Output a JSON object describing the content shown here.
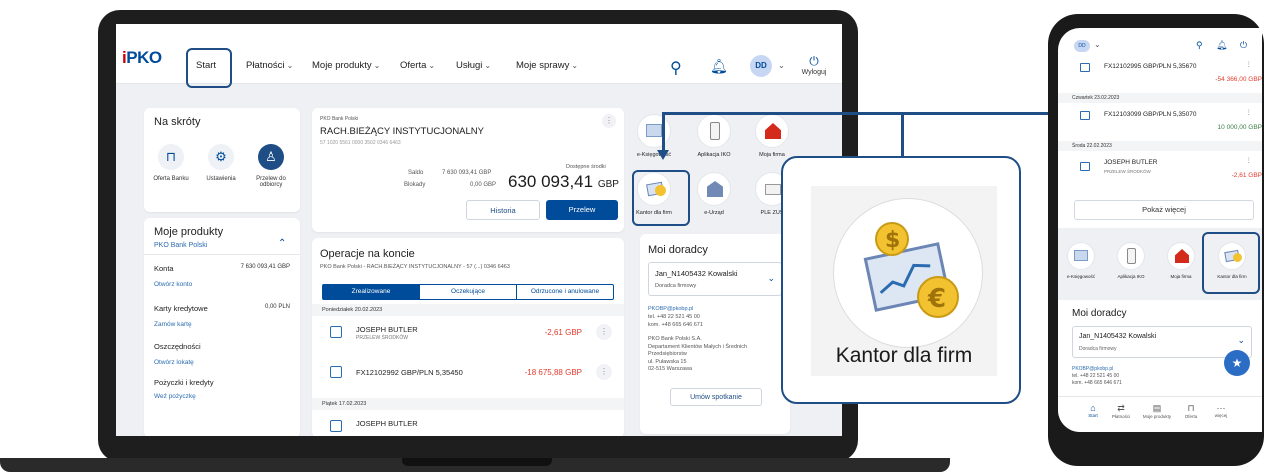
{
  "laptop": {
    "brand": "PKO",
    "nav": [
      {
        "label": "Start",
        "chev": false
      },
      {
        "label": "Płatności",
        "chev": true
      },
      {
        "label": "Moje produkty",
        "chev": true
      },
      {
        "label": "Oferta",
        "chev": true
      },
      {
        "label": "Usługi",
        "chev": true
      },
      {
        "label": "Moje sprawy",
        "chev": true
      }
    ],
    "avatar_initials": "DD",
    "logout_label": "Wyloguj",
    "shortcuts": {
      "title": "Na skróty",
      "items": [
        {
          "label": "Oferta Banku",
          "icon": "bag-icon"
        },
        {
          "label": "Ustawienia",
          "icon": "gear-icon"
        },
        {
          "label": "Przelew do odbiorcy",
          "icon": "person-icon"
        }
      ]
    },
    "products": {
      "title": "Moje produkty",
      "bank": "PKO Bank Polski",
      "rows": [
        {
          "label": "Konta",
          "value": "7 630 093,41 GBP",
          "link": "Otwórz konto"
        },
        {
          "label": "Karty kredytowe",
          "value": "0,00 PLN",
          "link": "Zamów kartę"
        },
        {
          "label": "Oszczędności",
          "value": "",
          "link": "Otwórz lokatę"
        },
        {
          "label": "Pożyczki i kredyty",
          "value": "",
          "link": "Weź pożyczkę"
        }
      ]
    },
    "account": {
      "bank": "PKO Bank Polski",
      "name": "RACH.BIEŻĄCY INSTYTUCJONALNY",
      "number": "57 1020 5561 0000 3502 0346 6463",
      "saldo_label": "Saldo",
      "saldo": "7 630 093,41 GBP",
      "blokady_label": "Blokady",
      "blokady": "0,00 GBP",
      "available_label": "Dostępne środki",
      "available": "630 093,41",
      "currency": "GBP",
      "history_btn": "Historia",
      "transfer_btn": "Przelew"
    },
    "operations": {
      "title": "Operacje na koncie",
      "subtitle": "PKO Bank Polski - RACH.BIEŻĄCY INSTYTUCJONALNY - 57 (...) 0346 6463",
      "tabs": [
        "Zrealizowane",
        "Oczekujące",
        "Odrzucone i anulowane"
      ],
      "date1": "Poniedziałek 20.02.2023",
      "op1_name": "JOSEPH BUTLER",
      "op1_sub": "PRZELEW ŚRODKÓW",
      "op1_amt": "-2,61 GBP",
      "op2_name": "FX12102992 GBP/PLN 5,35450",
      "op2_amt": "-18 675,88 GBP",
      "date2": "Piątek 17.02.2023",
      "op3_name": "JOSEPH BUTLER"
    },
    "tiles": [
      {
        "label": "e-Księgowość"
      },
      {
        "label": "Aplikacja IKO"
      },
      {
        "label": "Moja firma"
      },
      {
        "label": "Kantor dla firm"
      },
      {
        "label": "e-Urząd"
      },
      {
        "label": "PLE ZUS"
      }
    ],
    "advisors": {
      "title": "Moi doradcy",
      "name": "Jan_N1405432 Kowalski",
      "role": "Doradca firmowy",
      "email": "PKOBP@pkobp.pl",
      "tel": "tel. +48 22 521 45 00",
      "kom": "kom. +48 665 646 671",
      "address": [
        "PKO Bank Polski S.A.",
        "Departament Klientów Małych i Średnich",
        "Przedsiębiorstw",
        "ul. Puławska 15",
        "02-515 Warszawa"
      ],
      "button": "Umów spotkanie"
    }
  },
  "zoom": {
    "label": "Kantor dla firm"
  },
  "phone": {
    "avatar_initials": "DD",
    "op1": {
      "name": "FX12102995 GBP/PLN 5,35670",
      "amt": "-54 366,00 GBP"
    },
    "date1": "Czwartek 23.02.2023",
    "op2": {
      "name": "FX12103099 GBP/PLN 5,35070",
      "amt": "10 000,00 GBP"
    },
    "date2": "Środa 22.02.2023",
    "op3": {
      "name": "JOSEPH BUTLER",
      "sub": "PRZELEW ŚRODKÓW",
      "amt": "-2,61 GBP"
    },
    "show_more": "Pokaż więcej",
    "tiles": [
      {
        "label": "e-Księgowość"
      },
      {
        "label": "Aplikacja IKO"
      },
      {
        "label": "Moja firma"
      },
      {
        "label": "Kantor dla firm"
      }
    ],
    "advisors": {
      "title": "Moi doradcy",
      "name": "Jan_N1405432 Kowalski",
      "role": "Doradca firmowy",
      "email": "PKOBP@pkobp.pl",
      "tel": "tel. +48 22 521 45 00",
      "kom": "kom. +48 665 646 671"
    },
    "bottom_nav": [
      {
        "label": "Start",
        "icon": "home-icon"
      },
      {
        "label": "Płatności",
        "icon": "transfer-icon"
      },
      {
        "label": "Moje produkty",
        "icon": "wallet-icon"
      },
      {
        "label": "Oferta",
        "icon": "bag-icon"
      },
      {
        "label": "więcej",
        "icon": "more-icon"
      }
    ]
  },
  "colors": {
    "brand_blue": "#004c9a",
    "highlight_border": "#1e4e85",
    "negative": "#e23b2e",
    "positive": "#3a7d44"
  }
}
